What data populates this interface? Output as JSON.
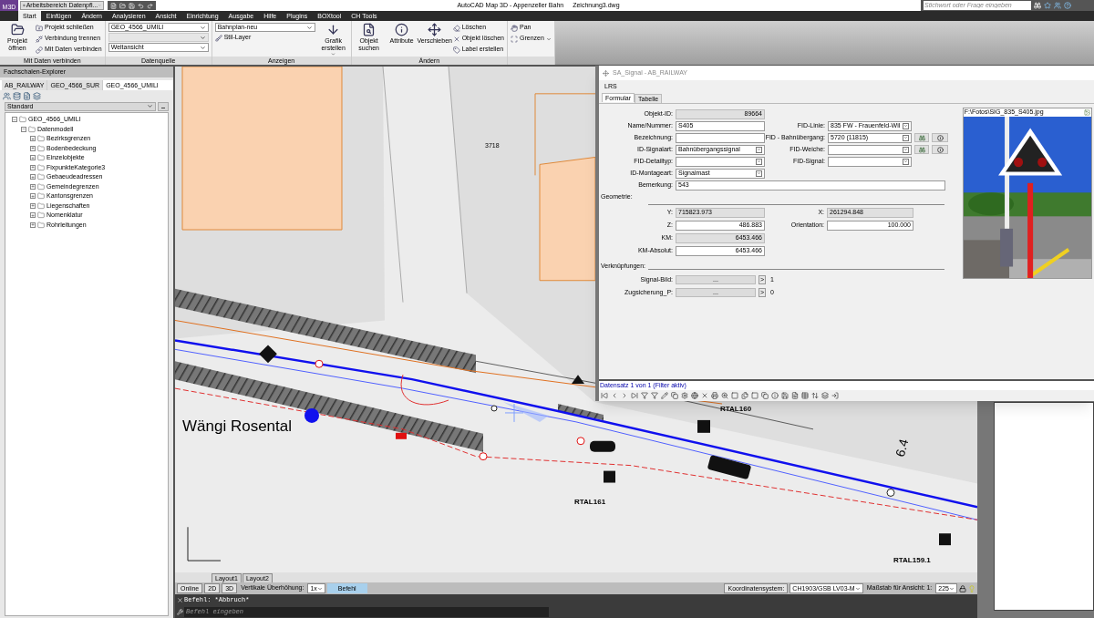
{
  "title_bar": {
    "app_badge": "M3D",
    "workspace": "Arbeitsbereich Datenpfl...",
    "title": "AutoCAD Map 3D - Appenzeller Bahn",
    "file": "Zeichnung3.dwg",
    "search": {
      "placeholder": "Stichwort oder Frage eingeben"
    }
  },
  "ribbon": {
    "tabs": [
      {
        "label": "Start",
        "selected": true
      },
      {
        "label": "Einfügen",
        "selected": false
      },
      {
        "label": "Ändern",
        "selected": false
      },
      {
        "label": "Analysieren",
        "selected": false
      },
      {
        "label": "Ansicht",
        "selected": false
      },
      {
        "label": "Einrichtung",
        "selected": false
      },
      {
        "label": "Ausgabe",
        "selected": false
      },
      {
        "label": "Hilfe",
        "selected": false
      },
      {
        "label": "Plugins",
        "selected": false
      },
      {
        "label": "BOXtool",
        "selected": false
      },
      {
        "label": "CH Tools",
        "selected": false
      }
    ],
    "panels": [
      {
        "title": "Mit Daten verbinden",
        "columns": [
          [
            {
              "kind": "large",
              "label": "Projekt öffnen"
            }
          ],
          [
            {
              "kind": "small",
              "label": "Projekt schließen"
            },
            {
              "kind": "small",
              "label": "Verbindung trennen"
            },
            {
              "kind": "small",
              "label": "Mit Daten verbinden"
            }
          ]
        ]
      },
      {
        "title": "Datenquelle",
        "columns": [
          [
            {
              "kind": "dropdown",
              "value": "GEO_4566_UMILI",
              "disabled": false
            },
            {
              "kind": "dropdown",
              "disabled": true
            },
            {
              "kind": "dropdown",
              "value": "Weltansicht",
              "disabled": false
            }
          ]
        ]
      },
      {
        "title": "Anzeigen",
        "columns": [
          [
            {
              "kind": "dropdown",
              "value": "Bahnplan-neu",
              "disabled": false
            },
            {
              "kind": "small",
              "label": "Stil-Layer"
            }
          ],
          [
            {
              "kind": "large",
              "label": "Grafik erstellen",
              "menu": true
            }
          ]
        ]
      },
      {
        "title": "Ändern",
        "columns": [
          [
            {
              "kind": "large",
              "label": "Objekt suchen"
            }
          ],
          [
            {
              "kind": "large",
              "label": "Attribute"
            }
          ],
          [
            {
              "kind": "large",
              "label": "Verschieben"
            }
          ],
          [
            {
              "kind": "small",
              "label": "Löschen"
            },
            {
              "kind": "small",
              "label": "Objekt löschen"
            },
            {
              "kind": "small",
              "label": "Label erstellen"
            }
          ]
        ]
      },
      {
        "columns": [
          [
            {
              "kind": "small",
              "label": "Pan"
            },
            {
              "kind": "small",
              "label": "Grenzen",
              "menu": true
            }
          ]
        ]
      }
    ]
  },
  "explorer": {
    "title": "Fachschalen-Explorer",
    "tabs": [
      {
        "label": "AB_RAILWAY",
        "selected": false
      },
      {
        "label": "GEO_4566_SUR",
        "selected": false
      },
      {
        "label": "GEO_4566_UMILI",
        "selected": true
      }
    ],
    "view": "Standard",
    "tree": [
      {
        "label": "GEO_4566_UMILI",
        "expanded": true,
        "children": [
          {
            "label": "Datenmodell",
            "expanded": true,
            "children": [
              {
                "label": "Bezirksgrenzen",
                "expanded": false
              },
              {
                "label": "Bodenbedeckung",
                "expanded": false
              },
              {
                "label": "Einzelobjekte",
                "expanded": false
              },
              {
                "label": "FixpunkteKategorie3",
                "expanded": false
              },
              {
                "label": "Gebaeudeadressen",
                "expanded": false
              },
              {
                "label": "Gemeindegrenzen",
                "expanded": false
              },
              {
                "label": "Kantonsgrenzen",
                "expanded": false
              },
              {
                "label": "Liegenschaften",
                "expanded": false
              },
              {
                "label": "Nomenklatur",
                "expanded": false
              },
              {
                "label": "Rohrleitungen",
                "expanded": false
              }
            ]
          }
        ]
      }
    ]
  },
  "map": {
    "labels": [
      {
        "kind": "station",
        "text": "Wängi Rosental"
      },
      {
        "kind": "code",
        "text": "RTAL160"
      },
      {
        "kind": "code",
        "text": "RTAL161"
      },
      {
        "kind": "code",
        "text": "RTAL159.1"
      },
      {
        "kind": "km",
        "text": "6.4"
      },
      {
        "kind": "parcel",
        "text": "3718"
      }
    ]
  },
  "form": {
    "title": "SA_Signal - AB_RAILWAY",
    "menu": "LRS",
    "tabs": [
      {
        "label": "Formular",
        "selected": true
      },
      {
        "label": "Tabelle",
        "selected": false
      }
    ],
    "left_fields": [
      {
        "label": "Objekt-ID:",
        "kind": "readonly_number",
        "value": "89664"
      },
      {
        "label": "Name/Nummer:",
        "kind": "text",
        "value": "S405"
      },
      {
        "label": "Bezeichnung:",
        "kind": "text"
      },
      {
        "label": "ID-Signalart:",
        "kind": "select",
        "value": "Bahnübergangssignal"
      },
      {
        "label": "FID-Detailtyp:",
        "kind": "select"
      },
      {
        "label": "ID-Montageart:",
        "kind": "select",
        "value": "Signalmast"
      }
    ],
    "right_fields": [
      {
        "label": "FID-Linie:",
        "kind": "select",
        "value": "835 FW - Frauenfeld-Wil"
      },
      {
        "label": "FID - Bahnübergang:",
        "kind": "lookup",
        "value": "5720 (11815)"
      },
      {
        "label": "FID-Weiche:",
        "kind": "lookup"
      },
      {
        "label": "FID-Signal:",
        "kind": "select"
      }
    ],
    "remark": {
      "label": "Bemerkung:",
      "value": "543"
    },
    "geometry": {
      "title": "Geometrie:",
      "left": [
        {
          "label": "Y:",
          "kind": "readonly_text",
          "value": "715823.973"
        },
        {
          "label": "Z:",
          "kind": "number",
          "value": "486.883"
        },
        {
          "label": "KM:",
          "kind": "readonly_number",
          "value": "6453.466"
        },
        {
          "label": "KM-Absolut:",
          "kind": "number",
          "value": "6453.466"
        }
      ],
      "right": [
        {
          "label": "X:",
          "kind": "readonly_text",
          "value": "261294.848"
        },
        {
          "label": "Orientation:",
          "kind": "number",
          "value": "100.000"
        }
      ]
    },
    "links": {
      "title": "Verknüpfungen:",
      "rows": [
        {
          "label": "Signal-Bild:",
          "button": "...",
          "arrow": ">",
          "count": "1"
        },
        {
          "label": "Zugsicherung_P:",
          "button": "...",
          "arrow": ">",
          "count": "0"
        }
      ]
    },
    "photo": {
      "path": "F:\\Fotos\\SIG_835_S405.jpg"
    },
    "record_status": "Datensatz 1 von 1 (Filter aktiv)"
  },
  "layout_tabs": [
    {
      "label": "Layout1",
      "selected": false
    },
    {
      "label": "Layout2",
      "selected": false
    }
  ],
  "status_bar": {
    "left": [
      {
        "kind": "button",
        "text": "Online"
      },
      {
        "kind": "button",
        "text": "2D"
      },
      {
        "kind": "button",
        "text": "3D"
      },
      {
        "kind": "label",
        "text": "Vertikale Überhöhung:"
      },
      {
        "kind": "dropdown",
        "text": "1x"
      },
      {
        "kind": "tab",
        "text": "Befehl"
      }
    ],
    "right": [
      {
        "kind": "button",
        "text": "Koordinatensystem:"
      },
      {
        "kind": "dropdown",
        "text": "CH1903/GSB LV03-M"
      },
      {
        "kind": "label",
        "text": "Maßstab für Ansicht: 1:"
      },
      {
        "kind": "dropdown",
        "text": "225"
      }
    ]
  },
  "command_line": {
    "history": "Befehl: *Abbruch*",
    "placeholder": "Befehl eingeben"
  }
}
